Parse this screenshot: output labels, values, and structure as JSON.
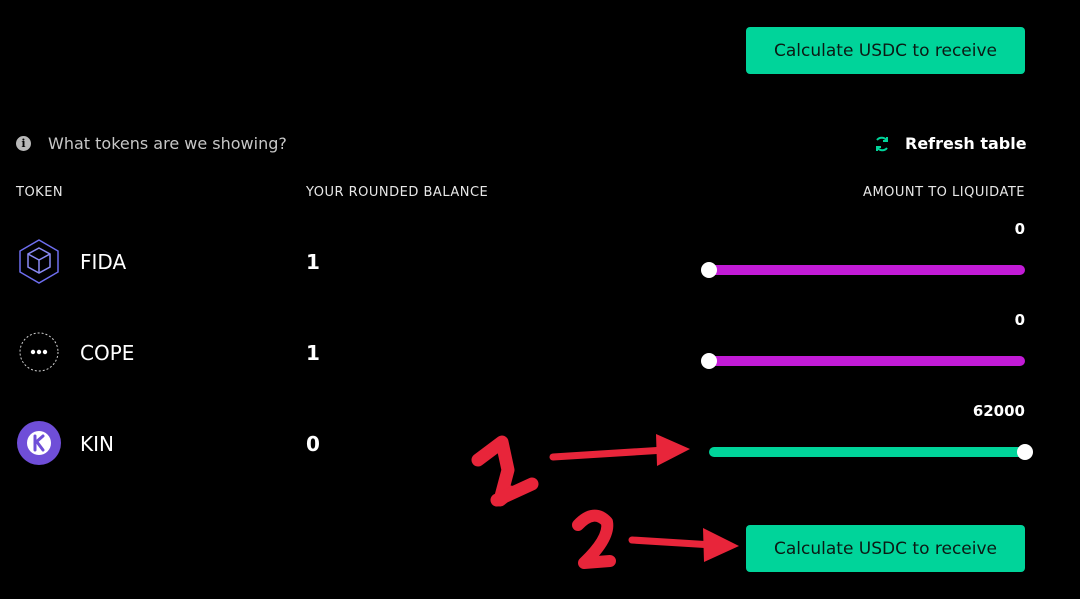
{
  "buttons": {
    "calculate_top": "Calculate USDC to receive",
    "calculate_bottom": "Calculate USDC to receive"
  },
  "info": {
    "text": "What tokens are we showing?",
    "icon": "info-icon"
  },
  "refresh": {
    "label": "Refresh table",
    "icon": "refresh-icon"
  },
  "table": {
    "headers": {
      "token": "TOKEN",
      "balance": "YOUR ROUNDED BALANCE",
      "amount": "AMOUNT TO LIQUIDATE"
    },
    "rows": [
      {
        "token": "FIDA",
        "icon": "fida-cube-icon",
        "balance": "1",
        "amount": "0",
        "slider_fraction": 0,
        "track_color": "#c21bd6"
      },
      {
        "token": "COPE",
        "icon": "cope-dots-icon",
        "balance": "1",
        "amount": "0",
        "slider_fraction": 0,
        "track_color": "#c21bd6"
      },
      {
        "token": "KIN",
        "icon": "kin-logo-icon",
        "balance": "0",
        "amount": "62000",
        "slider_fraction": 1,
        "track_color": "#00d49a"
      }
    ]
  },
  "annotations": {
    "mark1": "1",
    "mark2": "2",
    "color": "#e8253a"
  },
  "colors": {
    "accent": "#00d49a",
    "slider_magenta": "#c21bd6",
    "background": "#000000"
  }
}
